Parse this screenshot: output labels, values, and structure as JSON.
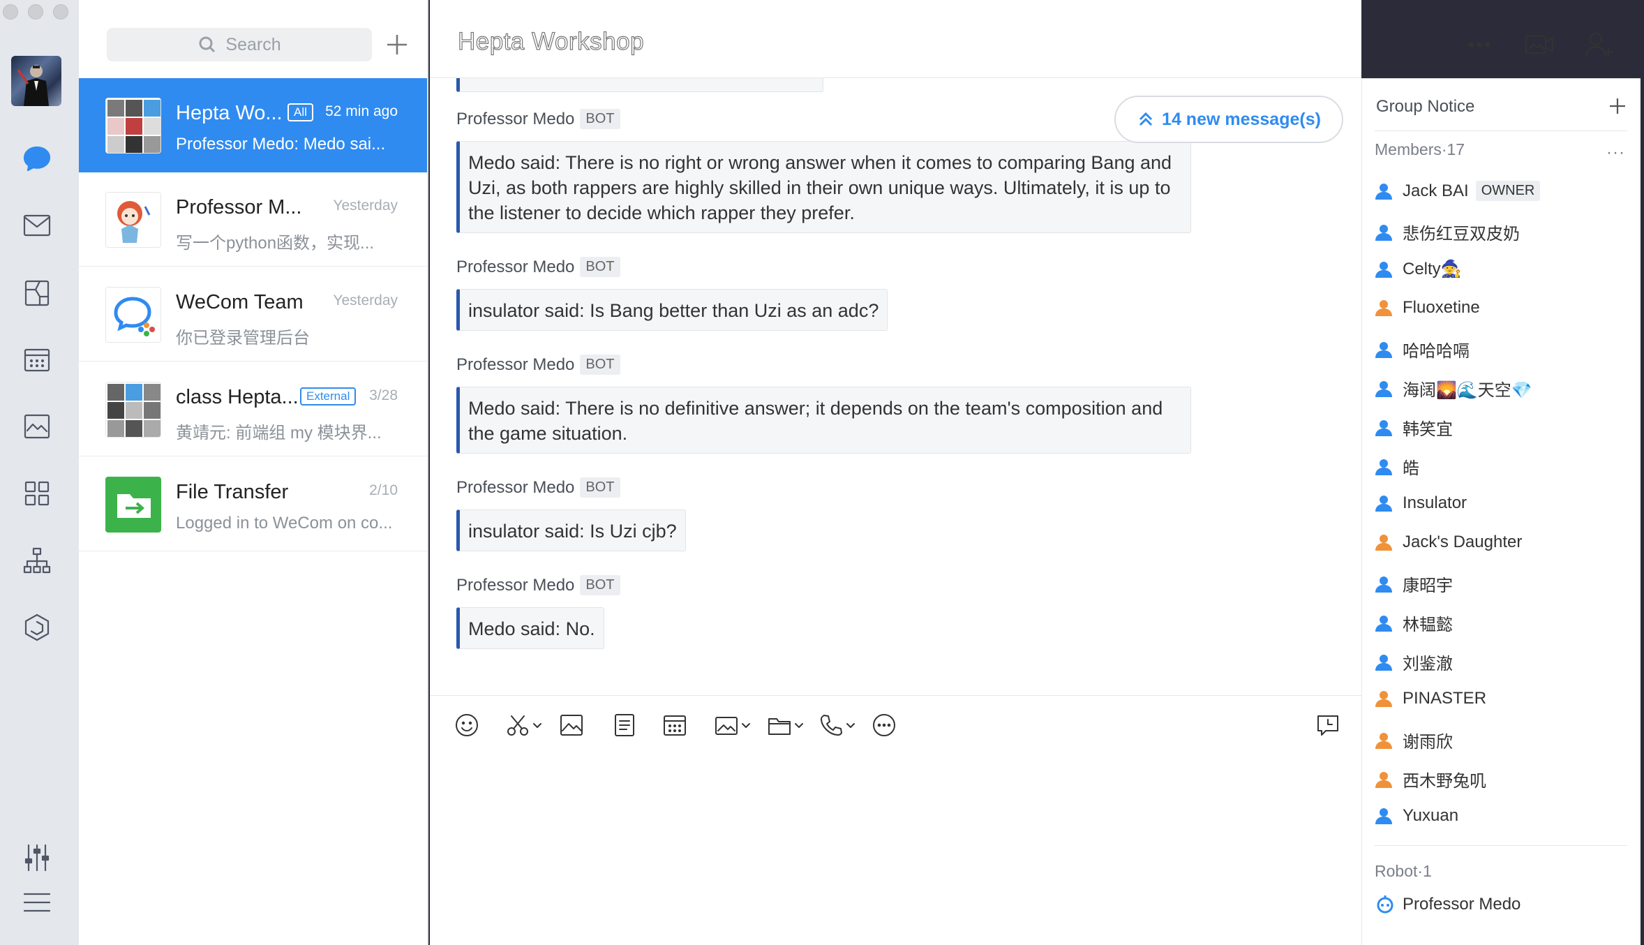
{
  "search": {
    "placeholder": "Search"
  },
  "chat": {
    "title": "Hepta Workshop",
    "new_messages": "14 new message(s)",
    "messages": [
      {
        "sender": "Professor Medo",
        "tag": "BOT",
        "text": "Medo said: There is no right or wrong answer when it comes to comparing Bang and Uzi, as both rappers are highly skilled in their own unique ways. Ultimately, it is up to the listener to decide which rapper they prefer."
      },
      {
        "sender": "Professor Medo",
        "tag": "BOT",
        "text": "insulator said: Is Bang better than Uzi as an adc?"
      },
      {
        "sender": "Professor Medo",
        "tag": "BOT",
        "text": "Medo said: There is no definitive answer; it depends on the team's composition and the game situation."
      },
      {
        "sender": "Professor Medo",
        "tag": "BOT",
        "text": "insulator said: Is Uzi cjb?"
      },
      {
        "sender": "Professor Medo",
        "tag": "BOT",
        "text": "Medo said: No."
      }
    ]
  },
  "conversations": [
    {
      "name": "Hepta Wo...",
      "tag": "All",
      "time": "52 min ago",
      "preview": "Professor Medo: Medo sai..."
    },
    {
      "name": "Professor M...",
      "tag": "",
      "time": "Yesterday",
      "preview": "写一个python函数，实现..."
    },
    {
      "name": "WeCom Team",
      "tag": "",
      "time": "Yesterday",
      "preview": "你已登录管理后台"
    },
    {
      "name": "class Hepta...",
      "tag": "External",
      "time": "3/28",
      "preview": "黄靖元: 前端组 my 模块界..."
    },
    {
      "name": "File Transfer",
      "tag": "",
      "time": "2/10",
      "preview": "Logged in to WeCom on co..."
    }
  ],
  "sidebar": {
    "group_notice": "Group Notice",
    "members_title": "Members·17",
    "owner_tag": "OWNER",
    "members": [
      {
        "name": "Jack BAI",
        "color": "#2f8bf0"
      },
      {
        "name": "悲伤红豆双皮奶",
        "color": "#2f8bf0"
      },
      {
        "name": "Celty🧙",
        "color": "#2f8bf0"
      },
      {
        "name": "Fluoxetine",
        "color": "#f0923a"
      },
      {
        "name": "哈哈哈嗝",
        "color": "#2f8bf0"
      },
      {
        "name": "海阔🌄🌊天空💎",
        "color": "#2f8bf0"
      },
      {
        "name": "韩笑宜",
        "color": "#2f8bf0"
      },
      {
        "name": "皓",
        "color": "#2f8bf0"
      },
      {
        "name": "Insulator",
        "color": "#2f8bf0"
      },
      {
        "name": "Jack's Daughter",
        "color": "#f0923a"
      },
      {
        "name": "康昭宇",
        "color": "#2f8bf0"
      },
      {
        "name": "林韫懿",
        "color": "#2f8bf0"
      },
      {
        "name": "刘鉴澈",
        "color": "#2f8bf0"
      },
      {
        "name": "PINASTER",
        "color": "#f0923a"
      },
      {
        "name": "谢雨欣",
        "color": "#f0923a"
      },
      {
        "name": "西木野兔叽",
        "color": "#f0923a"
      },
      {
        "name": "Yuxuan",
        "color": "#2f8bf0"
      }
    ],
    "robot_title": "Robot·1",
    "robot_name": "Professor Medo"
  },
  "icons": {
    "rail": [
      "messages-icon",
      "mail-icon",
      "docs-icon",
      "calendar-icon",
      "drive-icon",
      "workbench-icon",
      "contacts-icon",
      "apps-icon",
      "settings-icon",
      "menu-icon"
    ],
    "toolbar": [
      "emoji-icon",
      "screenshot-icon",
      "image-icon",
      "document-icon",
      "calendar-icon",
      "photo-icon",
      "folder-icon",
      "call-icon",
      "more-icon",
      "history-icon"
    ]
  },
  "colors": {
    "accent": "#2f8bf0",
    "bubble_border": "#2a58ad",
    "orange": "#f0923a"
  }
}
